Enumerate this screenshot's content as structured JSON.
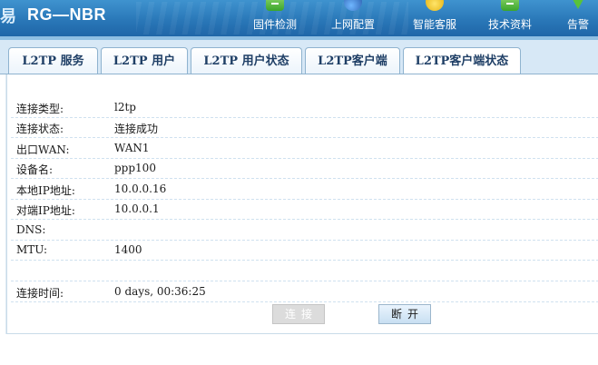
{
  "header": {
    "logo_glyph": "易",
    "brand": "RG—NBR",
    "nav": [
      {
        "label": "固件检测",
        "icon": "download-icon"
      },
      {
        "label": "上网配置",
        "icon": "globe-icon"
      },
      {
        "label": "智能客服",
        "icon": "smiley-icon"
      },
      {
        "label": "技术资料",
        "icon": "download-icon"
      },
      {
        "label": "告警",
        "icon": "warning-icon"
      }
    ]
  },
  "tabs": [
    {
      "label": "L2TP 服务"
    },
    {
      "label": "L2TP 用户"
    },
    {
      "label": "L2TP 用户状态"
    },
    {
      "label": "L2TP客户端"
    },
    {
      "label": "L2TP客户端状态",
      "active": true
    }
  ],
  "status": {
    "rows": [
      {
        "key": "连接类型:",
        "value": "l2tp"
      },
      {
        "key": "连接状态:",
        "value": "连接成功"
      },
      {
        "key": "出口WAN:",
        "value": "WAN1"
      },
      {
        "key": "设备名:",
        "value": "ppp100"
      },
      {
        "key": "本地IP地址:",
        "value": "10.0.0.16"
      },
      {
        "key": "对端IP地址:",
        "value": "10.0.0.1"
      },
      {
        "key": "DNS:",
        "value": ""
      },
      {
        "key": "MTU:",
        "value": "1400"
      },
      {
        "key": "",
        "value": ""
      },
      {
        "key": "连接时间:",
        "value": "0 days, 00:36:25"
      }
    ]
  },
  "buttons": {
    "connect_label": "连接",
    "disconnect_label": "断开"
  },
  "colors": {
    "header_bg": "#2a78b8",
    "tab_text": "#1f3f66",
    "disabled_button": "#dcdcdc",
    "active_button": "#c8dff2"
  }
}
